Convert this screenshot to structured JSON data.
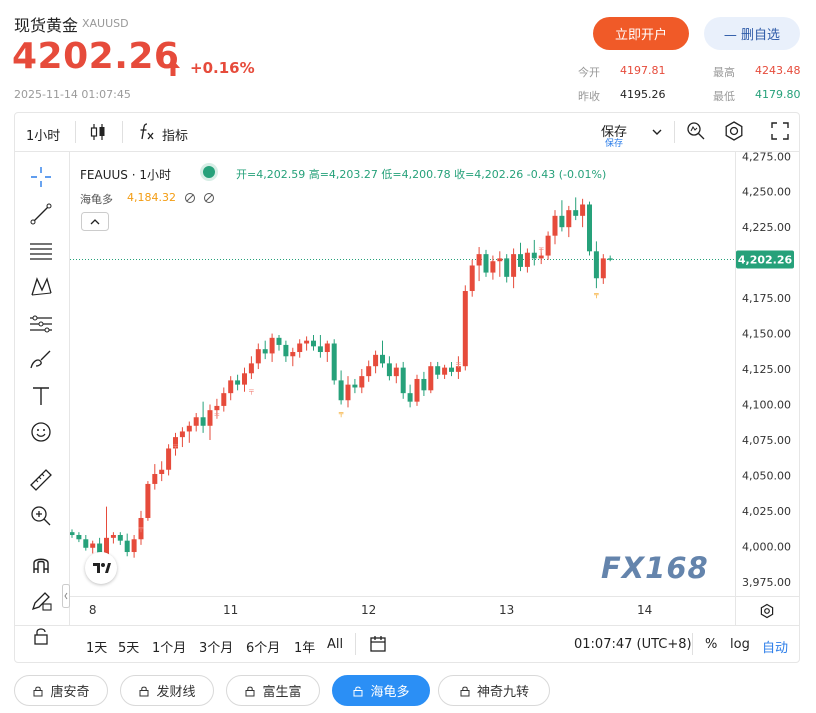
{
  "header": {
    "title": "现货黄金",
    "symbol": "XAUUSD",
    "price": "4202.26",
    "change_pct": "+0.16%",
    "timestamp": "2025-11-14 01:07:45",
    "open_account_label": "立即开户",
    "watchlist_label": "— 删自选",
    "stats": {
      "today_open_label": "今开",
      "today_open": "4197.81",
      "high_label": "最高",
      "high": "4243.48",
      "prev_close_label": "昨收",
      "prev_close": "4195.26",
      "low_label": "最低",
      "low": "4179.80"
    }
  },
  "toolbar": {
    "interval": "1小时",
    "indicators_label": "指标",
    "save_label": "保存",
    "save_sub": "保存"
  },
  "legend": {
    "symbol": "FEAUUS · 1小时",
    "ohlc_text": "开=4,202.59 高=4,203.27 低=4,200.78 收=4,202.26 -0.43 (-0.01%)",
    "indicator_name": "海龟多",
    "indicator_value": "4,184.32"
  },
  "watermark": "FX168",
  "bottom_bar": {
    "ranges": [
      "1天",
      "5天",
      "1个月",
      "3个月",
      "6个月",
      "1年",
      "All"
    ],
    "clock": "01:07:47 (UTC+8)",
    "pct": "%",
    "log": "log",
    "auto": "自动"
  },
  "tags": [
    {
      "label": "唐安奇",
      "active": false
    },
    {
      "label": "发财线",
      "active": false
    },
    {
      "label": "富生富",
      "active": false
    },
    {
      "label": "海龟多",
      "active": true
    },
    {
      "label": "神奇九转",
      "active": false
    }
  ],
  "colors": {
    "up": "#e64b3b",
    "down": "#26a17a",
    "accent": "#2b8ff5",
    "last_price_tag": "#26a17a"
  },
  "chart_data": {
    "type": "candlestick",
    "interval": "1小时",
    "y_ticks": [
      "4,275.00",
      "4,250.00",
      "4,225.00",
      "4,200.00",
      "4,175.00",
      "4,150.00",
      "4,125.00",
      "4,100.00",
      "4,075.00",
      "4,050.00",
      "4,025.00",
      "4,000.00",
      "3,975.00"
    ],
    "ylim": [
      3965,
      4278
    ],
    "x_ticks": [
      {
        "label": "8",
        "index": 3
      },
      {
        "label": "11",
        "index": 23
      },
      {
        "label": "12",
        "index": 43
      },
      {
        "label": "13",
        "index": 63
      },
      {
        "label": "14",
        "index": 83
      }
    ],
    "last_price": 4202.26,
    "last_price_label": "4,202.26",
    "candles": [
      [
        4010,
        4012,
        4006,
        4008
      ],
      [
        4008,
        4010,
        4003,
        4005
      ],
      [
        4005,
        4008,
        3997,
        3999
      ],
      [
        3999,
        4004,
        3995,
        4002
      ],
      [
        4002,
        4006,
        3990,
        3993
      ],
      [
        3993,
        4028,
        3990,
        4006
      ],
      [
        4006,
        4010,
        4002,
        4008
      ],
      [
        4008,
        4010,
        4001,
        4004
      ],
      [
        4004,
        4009,
        3993,
        3996
      ],
      [
        3996,
        4008,
        3992,
        4005
      ],
      [
        4005,
        4025,
        4001,
        4020
      ],
      [
        4020,
        4046,
        4018,
        4044
      ],
      [
        4044,
        4058,
        4040,
        4051
      ],
      [
        4051,
        4060,
        4046,
        4054
      ],
      [
        4054,
        4072,
        4050,
        4069
      ],
      [
        4069,
        4080,
        4064,
        4077
      ],
      [
        4077,
        4084,
        4070,
        4081
      ],
      [
        4081,
        4088,
        4073,
        4085
      ],
      [
        4085,
        4094,
        4081,
        4091
      ],
      [
        4091,
        4102,
        4080,
        4085
      ],
      [
        4085,
        4100,
        4075,
        4096
      ],
      [
        4096,
        4104,
        4090,
        4099
      ],
      [
        4099,
        4112,
        4095,
        4108
      ],
      [
        4108,
        4120,
        4103,
        4117
      ],
      [
        4117,
        4121,
        4110,
        4114
      ],
      [
        4114,
        4126,
        4109,
        4122
      ],
      [
        4122,
        4134,
        4118,
        4129
      ],
      [
        4129,
        4143,
        4125,
        4139
      ],
      [
        4139,
        4145,
        4132,
        4136
      ],
      [
        4136,
        4150,
        4130,
        4147
      ],
      [
        4147,
        4149,
        4138,
        4142
      ],
      [
        4142,
        4145,
        4130,
        4134
      ],
      [
        4134,
        4140,
        4127,
        4137
      ],
      [
        4137,
        4146,
        4133,
        4143
      ],
      [
        4143,
        4148,
        4138,
        4145
      ],
      [
        4145,
        4149,
        4138,
        4141
      ],
      [
        4141,
        4149,
        4133,
        4137
      ],
      [
        4137,
        4145,
        4130,
        4143
      ],
      [
        4143,
        4146,
        4114,
        4117
      ],
      [
        4117,
        4124,
        4100,
        4103
      ],
      [
        4103,
        4120,
        4098,
        4114
      ],
      [
        4114,
        4118,
        4108,
        4112
      ],
      [
        4112,
        4125,
        4108,
        4120
      ],
      [
        4120,
        4131,
        4116,
        4127
      ],
      [
        4127,
        4138,
        4122,
        4135
      ],
      [
        4135,
        4145,
        4126,
        4129
      ],
      [
        4129,
        4134,
        4117,
        4120
      ],
      [
        4120,
        4129,
        4115,
        4126
      ],
      [
        4126,
        4130,
        4104,
        4108
      ],
      [
        4108,
        4114,
        4098,
        4102
      ],
      [
        4102,
        4121,
        4099,
        4118
      ],
      [
        4118,
        4123,
        4106,
        4110
      ],
      [
        4110,
        4130,
        4108,
        4127
      ],
      [
        4127,
        4130,
        4118,
        4121
      ],
      [
        4121,
        4128,
        4118,
        4126
      ],
      [
        4126,
        4130,
        4120,
        4123
      ],
      [
        4123,
        4134,
        4118,
        4127
      ],
      [
        4127,
        4184,
        4124,
        4180
      ],
      [
        4180,
        4202,
        4176,
        4198
      ],
      [
        4198,
        4211,
        4187,
        4206
      ],
      [
        4206,
        4209,
        4190,
        4193
      ],
      [
        4193,
        4205,
        4188,
        4201
      ],
      [
        4201,
        4208,
        4190,
        4203
      ],
      [
        4203,
        4206,
        4186,
        4190
      ],
      [
        4190,
        4210,
        4182,
        4206
      ],
      [
        4206,
        4214,
        4194,
        4197
      ],
      [
        4197,
        4210,
        4193,
        4207
      ],
      [
        4207,
        4216,
        4198,
        4203
      ],
      [
        4203,
        4210,
        4199,
        4205
      ],
      [
        4205,
        4222,
        4202,
        4219
      ],
      [
        4219,
        4237,
        4213,
        4233
      ],
      [
        4233,
        4244,
        4222,
        4225
      ],
      [
        4225,
        4240,
        4218,
        4237
      ],
      [
        4237,
        4246,
        4230,
        4233
      ],
      [
        4233,
        4245,
        4225,
        4241
      ],
      [
        4241,
        4243,
        4205,
        4208
      ],
      [
        4208,
        4215,
        4182,
        4189
      ],
      [
        4189,
        4206,
        4185,
        4203
      ],
      [
        4203,
        4205,
        4201,
        4202
      ]
    ],
    "markers": [
      {
        "index": 10,
        "price": 4013,
        "side": "up"
      },
      {
        "index": 15,
        "price": 4071,
        "side": "up"
      },
      {
        "index": 21,
        "price": 4093,
        "side": "up"
      },
      {
        "index": 26,
        "price": 4110,
        "side": "up"
      },
      {
        "index": 39,
        "price": 4094,
        "side": "down"
      },
      {
        "index": 56,
        "price": 4129,
        "side": "up"
      },
      {
        "index": 68,
        "price": 4210,
        "side": "up"
      },
      {
        "index": 76,
        "price": 4178,
        "side": "down"
      }
    ]
  }
}
